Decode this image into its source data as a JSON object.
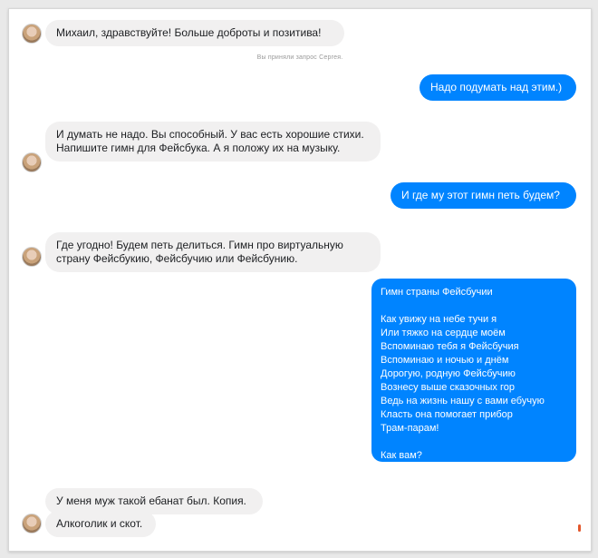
{
  "messages": {
    "m1": "Михаил, здравствуйте! Больше доброты и позитива!",
    "system": "Вы приняли запрос Сергея.",
    "m2": "Надо подумать над этим.)",
    "m3": "И думать не надо. Вы способный. У вас есть хорошие стихи. Напишите гимн  для Фейсбука. А я положу их на музыку.",
    "m4": "И где му этот гимн петь будем?",
    "m5": "Где угодно! Будем петь делиться. Гимн про виртуальную страну Фейсбукию, Фейсбучию или Фейсбунию.",
    "m7": "У меня муж такой ебанат был. Копия.",
    "m8": "Алкоголик и скот."
  },
  "poem": {
    "title": "Гимн страны Фейсбучии",
    "lines": [
      "Как увижу на небе тучи я",
      "Или тяжко на сердце моём",
      "Вспоминаю тебя я Фейсбучия",
      "Вспоминаю и ночью и днём",
      "Дорогую, родную Фейсбучию",
      "Вознесу выше сказочных гор",
      "Ведь на жизнь нашу с вами ебучую",
      "Класть она помогает прибор",
      "Трам-парам!"
    ],
    "question": "Как вам?"
  },
  "colors": {
    "outgoing": "#0084ff",
    "incoming": "#f1f0f0"
  }
}
